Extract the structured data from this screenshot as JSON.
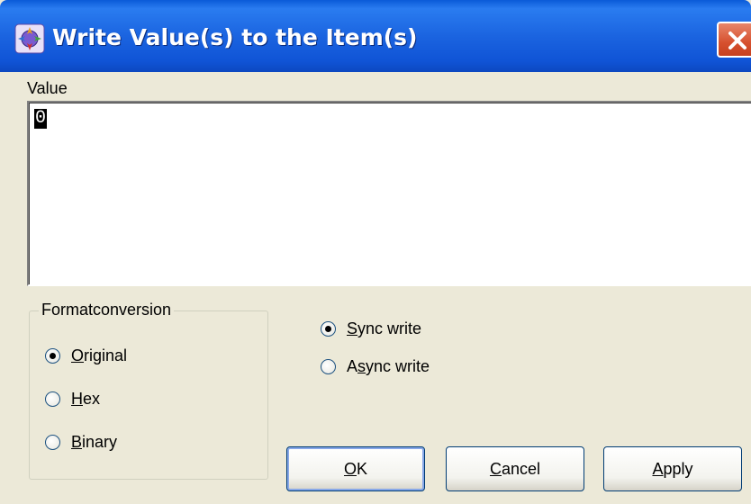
{
  "window": {
    "title": "Write Value(s) to the Item(s)",
    "icon": "app-icon"
  },
  "value": {
    "label": "Value",
    "content": "0"
  },
  "format": {
    "legend": "Formatconversion",
    "options": [
      {
        "label": "Original",
        "mnemonic": "O",
        "rest": "riginal",
        "selected": true
      },
      {
        "label": "Hex",
        "mnemonic": "H",
        "rest": "ex",
        "selected": false
      },
      {
        "label": "Binary",
        "mnemonic": "B",
        "rest": "inary",
        "selected": false
      }
    ]
  },
  "write_mode": {
    "options": [
      {
        "label": "Sync write",
        "pre": "",
        "mnemonic": "S",
        "rest": "ync write",
        "selected": true
      },
      {
        "label": "Async write",
        "pre": "A",
        "mnemonic": "s",
        "rest": "ync write",
        "selected": false
      }
    ]
  },
  "buttons": {
    "ok": {
      "label": "OK",
      "mnemonic": "O",
      "rest": "K"
    },
    "cancel": {
      "label": "Cancel",
      "mnemonic": "C",
      "rest": "ancel"
    },
    "apply": {
      "label": "Apply",
      "mnemonic": "A",
      "rest": "pply"
    }
  },
  "colors": {
    "titlebar": "#1b64e0",
    "dialog_bg": "#ece9d8",
    "close": "#d6502e"
  }
}
